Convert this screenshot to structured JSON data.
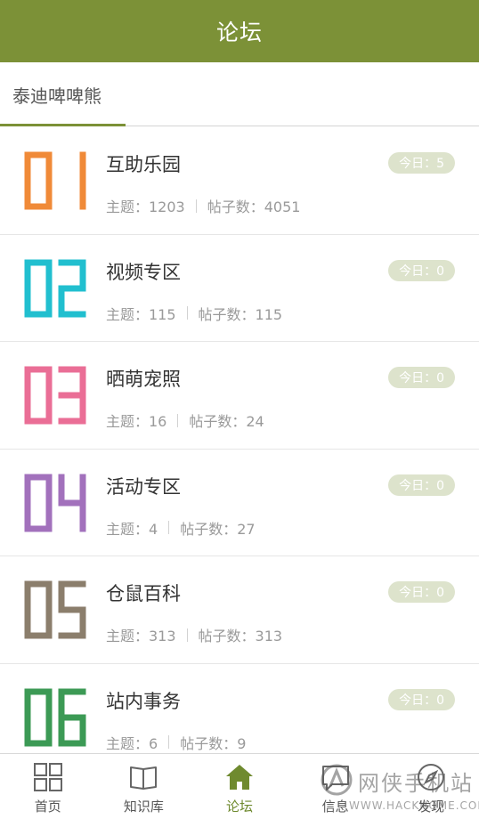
{
  "header": {
    "title": "论坛"
  },
  "subtabs": [
    {
      "label": "泰迪啤啤熊"
    }
  ],
  "forums": [
    {
      "number": "01",
      "color": "#f08a38",
      "title": "互助乐园",
      "topics_label": "主题：1203",
      "posts_label": "帖子数：4051",
      "today_label": "今日：5"
    },
    {
      "number": "02",
      "color": "#21bfcf",
      "title": "视频专区",
      "topics_label": "主题：115",
      "posts_label": "帖子数：115",
      "today_label": "今日：0"
    },
    {
      "number": "03",
      "color": "#ea6e96",
      "title": "晒萌宠照",
      "topics_label": "主题：16",
      "posts_label": "帖子数：24",
      "today_label": "今日：0"
    },
    {
      "number": "04",
      "color": "#a271bc",
      "title": "活动专区",
      "topics_label": "主题：4",
      "posts_label": "帖子数：27",
      "today_label": "今日：0"
    },
    {
      "number": "05",
      "color": "#8b7e6c",
      "title": "仓鼠百科",
      "topics_label": "主题：313",
      "posts_label": "帖子数：313",
      "today_label": "今日：0"
    },
    {
      "number": "06",
      "color": "#3c9a55",
      "title": "站内事务",
      "topics_label": "主题：6",
      "posts_label": "帖子数：9",
      "today_label": "今日：0"
    }
  ],
  "tabbar": {
    "items": [
      {
        "label": "首页",
        "icon": "grid-icon"
      },
      {
        "label": "知识库",
        "icon": "book-icon"
      },
      {
        "label": "论坛",
        "icon": "home-icon",
        "active": true
      },
      {
        "label": "信息",
        "icon": "message-icon"
      },
      {
        "label": "发现",
        "icon": "compass-icon"
      }
    ],
    "active_color": "#6f8a2f"
  },
  "watermark": {
    "line1": "网侠手机站",
    "line2": "WWW.HACKHOME.COM"
  },
  "colors": {
    "brand": "#7c9137",
    "badge_bg": "#dde3cc"
  }
}
